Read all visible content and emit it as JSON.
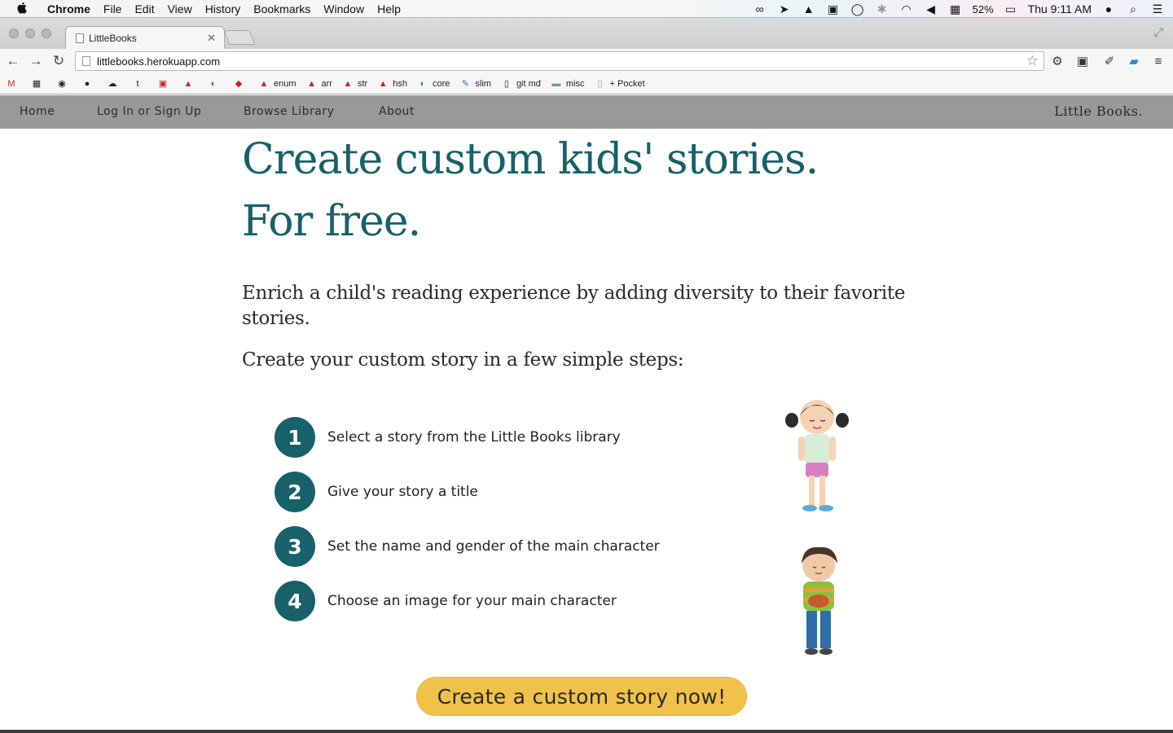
{
  "menubar": {
    "app_name": "Chrome",
    "items": [
      "File",
      "Edit",
      "View",
      "History",
      "Bookmarks",
      "Window",
      "Help"
    ],
    "battery": "52%",
    "clock": "Thu 9:11 AM"
  },
  "browser": {
    "tab_title": "LittleBooks",
    "url": "littlebooks.herokuapp.com"
  },
  "bookmarks": [
    {
      "label": "enum"
    },
    {
      "label": "arr"
    },
    {
      "label": "str"
    },
    {
      "label": "hsh"
    },
    {
      "label": "core"
    },
    {
      "label": "slim"
    },
    {
      "label": "git md"
    },
    {
      "label": "misc"
    },
    {
      "label": "+ Pocket"
    }
  ],
  "site": {
    "nav": [
      "Home",
      "Log In or Sign Up",
      "Browse Library",
      "About"
    ],
    "brand": "Little Books."
  },
  "hero": {
    "line1": "Create custom kids' stories.",
    "line2": "For free."
  },
  "intro": "Enrich a child's reading experience by adding diversity to their favorite stories.",
  "steps_heading": "Create your custom story in a few simple steps:",
  "steps": [
    {
      "num": "1",
      "text": "Select a story from the Little Books library"
    },
    {
      "num": "2",
      "text": "Give your story a title"
    },
    {
      "num": "3",
      "text": "Set the name and gender of the main character"
    },
    {
      "num": "4",
      "text": "Choose an image for your main character"
    }
  ],
  "cta_label": "Create a custom story now!",
  "colors": {
    "brand_teal": "#18606a",
    "cta_yellow": "#f0c24a",
    "nav_gray": "#999999"
  }
}
